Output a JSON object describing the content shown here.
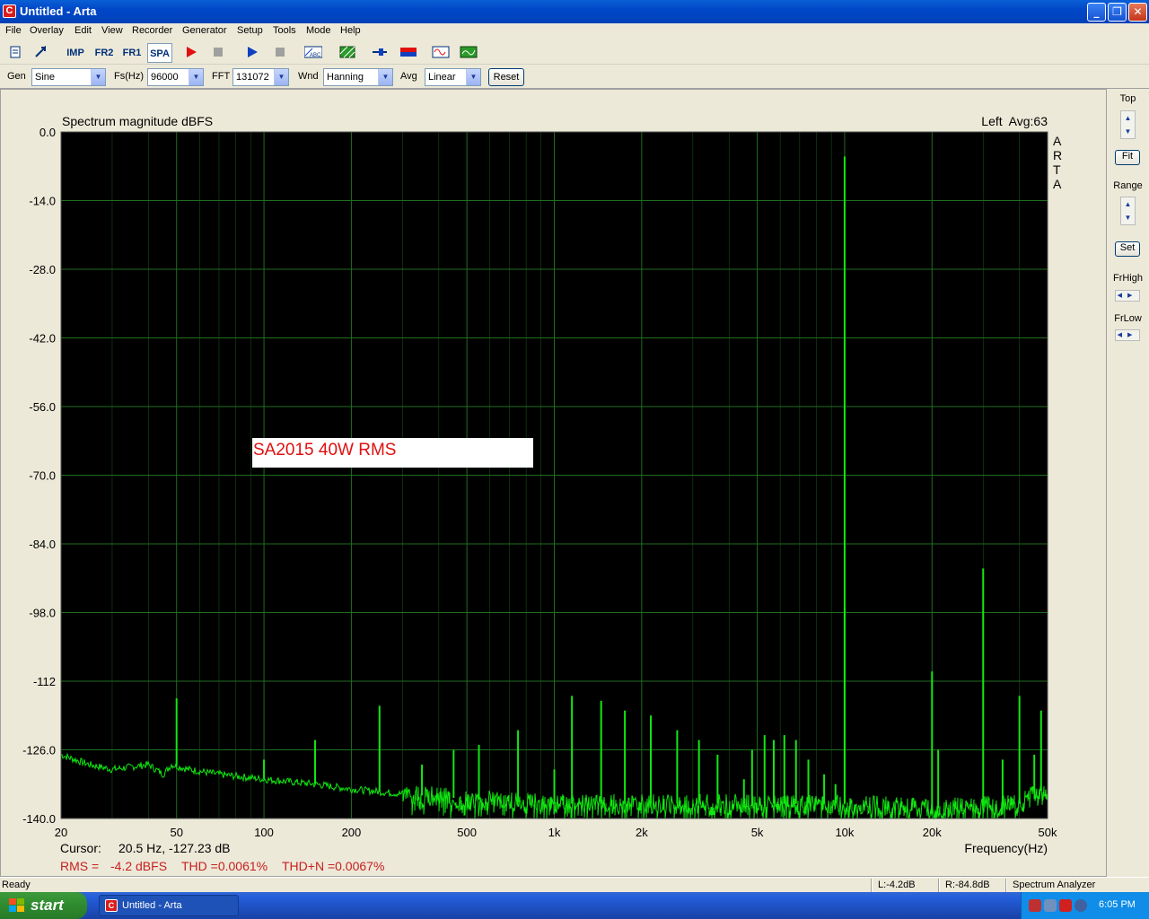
{
  "window": {
    "title": "Untitled - Arta",
    "icon": "arta-app-icon"
  },
  "menu": [
    "File",
    "Overlay",
    "Edit",
    "View",
    "Recorder",
    "Generator",
    "Setup",
    "Tools",
    "Mode",
    "Help"
  ],
  "toolbar": {
    "imp_label": "IMP",
    "fr2_label": "FR2",
    "fr1_label": "FR1",
    "spa_label": "SPA",
    "icons": [
      "new-file-icon",
      "open-icon",
      "record-icon",
      "stop-icon",
      "play-icon",
      "stop-icon",
      "abc-icon",
      "hatch-icon",
      "cursor-icon",
      "color-bar-icon",
      "sine-wave-icon",
      "spectrum-wave-icon"
    ]
  },
  "controls": {
    "gen_label": "Gen",
    "gen_value": "Sine",
    "fs_label": "Fs(Hz)",
    "fs_value": "96000",
    "fft_label": "FFT",
    "fft_value": "131072",
    "wnd_label": "Wnd",
    "wnd_value": "Hanning",
    "avg_label": "Avg",
    "avg_value": "Linear",
    "reset_label": "Reset"
  },
  "right_panel": {
    "top_label": "Top",
    "fit_label": "Fit",
    "range_label": "Range",
    "set_label": "Set",
    "frhigh_label": "FrHigh",
    "frlow_label": "FrLow"
  },
  "plot": {
    "cursor_label": "Cursor:",
    "cursor_value": "20.5 Hz, -127.23 dB",
    "rms_label": "RMS =",
    "rms_value": "-4.2 dBFS",
    "thd_text": "THD =0.0061%",
    "thdn_text": "THD+N =0.0067%",
    "annotation": "SA2015 40W RMS",
    "channel_avg": "Left  Avg:63",
    "watermark": [
      "A",
      "R",
      "T",
      "A"
    ],
    "colors": {
      "background": "#000000",
      "grid": "#1f6e1f",
      "trace": "#10e810",
      "annotation": "#e01010",
      "readout": "#c82020"
    }
  },
  "chart_data": {
    "type": "line",
    "title": "Spectrum magnitude dBFS",
    "xlabel": "Frequency(Hz)",
    "ylabel": "",
    "x_scale": "log",
    "xlim": [
      20,
      50000
    ],
    "ylim": [
      -140,
      0
    ],
    "grid": true,
    "y_ticks": [
      "0.0",
      "-14.0",
      "-28.0",
      "-42.0",
      "-56.0",
      "-70.0",
      "-84.0",
      "-98.0",
      "-112",
      "-126.0",
      "-140.0"
    ],
    "x_ticks": [
      {
        "value": 20,
        "label": "20"
      },
      {
        "value": 50,
        "label": "50"
      },
      {
        "value": 100,
        "label": "100"
      },
      {
        "value": 200,
        "label": "200"
      },
      {
        "value": 500,
        "label": "500"
      },
      {
        "value": 1000,
        "label": "1k"
      },
      {
        "value": 2000,
        "label": "2k"
      },
      {
        "value": 5000,
        "label": "5k"
      },
      {
        "value": 10000,
        "label": "10k"
      },
      {
        "value": 20000,
        "label": "20k"
      },
      {
        "value": 50000,
        "label": "50k"
      }
    ],
    "series": [
      {
        "noise_floor": [
          [
            20,
            -127
          ],
          [
            25,
            -129
          ],
          [
            30,
            -130
          ],
          [
            40,
            -129
          ],
          [
            45,
            -131
          ],
          [
            48,
            -129
          ],
          [
            55,
            -130
          ],
          [
            70,
            -131
          ],
          [
            100,
            -132
          ],
          [
            150,
            -133
          ],
          [
            200,
            -134
          ],
          [
            300,
            -135
          ],
          [
            500,
            -136
          ],
          [
            1000,
            -137
          ],
          [
            2000,
            -137
          ],
          [
            5000,
            -137
          ],
          [
            10000,
            -137
          ],
          [
            20000,
            -138
          ],
          [
            40000,
            -137
          ],
          [
            47000,
            -134
          ],
          [
            50000,
            -136
          ]
        ],
        "peaks": [
          [
            50,
            -115.5
          ],
          [
            100,
            -128
          ],
          [
            150,
            -124
          ],
          [
            250,
            -117
          ],
          [
            350,
            -129
          ],
          [
            450,
            -126
          ],
          [
            550,
            -125
          ],
          [
            750,
            -122
          ],
          [
            1000,
            -130
          ],
          [
            1150,
            -115
          ],
          [
            1450,
            -116
          ],
          [
            1750,
            -118
          ],
          [
            2150,
            -119
          ],
          [
            2650,
            -122
          ],
          [
            3150,
            -124
          ],
          [
            3650,
            -127
          ],
          [
            4500,
            -132
          ],
          [
            4800,
            -126
          ],
          [
            5300,
            -123
          ],
          [
            5700,
            -124
          ],
          [
            6200,
            -123
          ],
          [
            6800,
            -124
          ],
          [
            7500,
            -128
          ],
          [
            8500,
            -131
          ],
          [
            9300,
            -133
          ],
          [
            10000,
            -5
          ],
          [
            10000,
            -97
          ],
          [
            20000,
            -110
          ],
          [
            21000,
            -126
          ],
          [
            30000,
            -89
          ],
          [
            35000,
            -128
          ],
          [
            40000,
            -115
          ],
          [
            45000,
            -127
          ],
          [
            47500,
            -118
          ]
        ]
      }
    ]
  },
  "status": {
    "ready": "Ready",
    "left_level": "L:-4.2dB",
    "right_level": "R:-84.8dB",
    "mode": "Spectrum Analyzer"
  },
  "taskbar": {
    "start_label": "start",
    "task_label": "Untitled - Arta",
    "clock": "6:05 PM",
    "tray_icons": [
      "network-icon",
      "volume-icon",
      "shield-icon",
      "eset-icon"
    ]
  }
}
